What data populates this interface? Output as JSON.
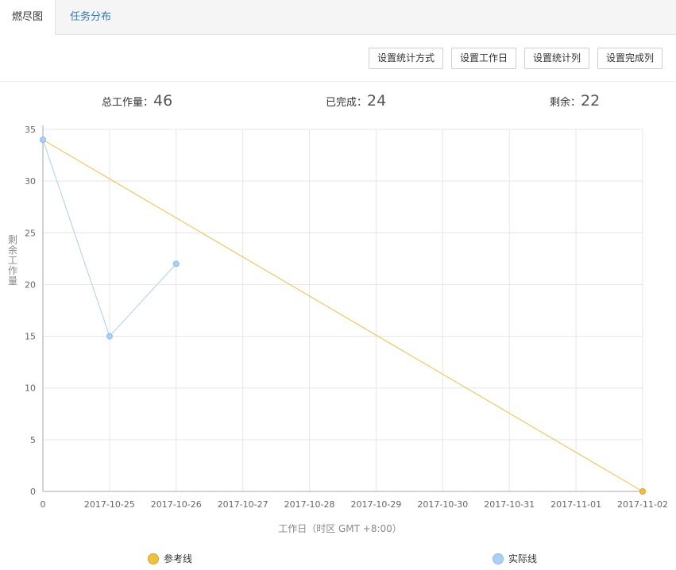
{
  "tabs": [
    {
      "label": "燃尽图",
      "active": true
    },
    {
      "label": "任务分布",
      "active": false
    }
  ],
  "toolbar": {
    "buttons": [
      "设置统计方式",
      "设置工作日",
      "设置统计列",
      "设置完成列"
    ]
  },
  "stats": {
    "total_label": "总工作量：",
    "total_value": "46",
    "done_label": "已完成：",
    "done_value": "24",
    "remaining_label": "剩余：",
    "remaining_value": "22"
  },
  "colors": {
    "reference": "#f0c040",
    "actual": "#a9d0f5"
  },
  "chart_data": {
    "type": "line",
    "title": "",
    "xlabel": "工作日（时区 GMT +8:00）",
    "ylabel": "剩余工作量",
    "categories": [
      "0",
      "2017-10-25",
      "2017-10-26",
      "2017-10-27",
      "2017-10-28",
      "2017-10-29",
      "2017-10-30",
      "2017-10-31",
      "2017-11-01",
      "2017-11-02"
    ],
    "ylim": [
      0,
      35
    ],
    "yticks": [
      0,
      5,
      10,
      15,
      20,
      25,
      30,
      35
    ],
    "grid": true,
    "legend_position": "bottom",
    "series": [
      {
        "name": "参考线",
        "values": [
          34,
          null,
          null,
          null,
          null,
          null,
          null,
          null,
          null,
          0
        ],
        "connect_gaps": true
      },
      {
        "name": "实际线",
        "values": [
          34,
          15,
          22,
          null,
          null,
          null,
          null,
          null,
          null,
          null
        ],
        "connect_gaps": false
      }
    ]
  }
}
